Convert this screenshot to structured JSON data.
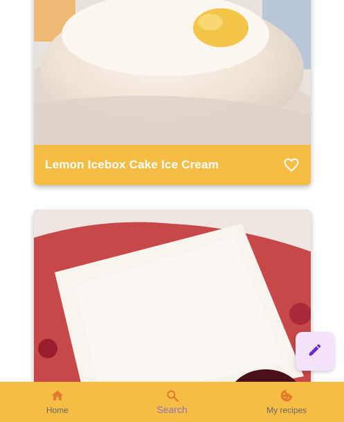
{
  "recipes": [
    {
      "title": "Lemon Icebox Cake Ice Cream",
      "favorite_icon": "heart-outline-icon"
    },
    {
      "title": "",
      "favorite_icon": "heart-outline-icon"
    }
  ],
  "fab": {
    "icon": "pencil-icon"
  },
  "bottom_nav": {
    "items": [
      {
        "label": "Home",
        "icon": "home-icon",
        "active": false
      },
      {
        "label": "Search",
        "icon": "search-icon",
        "active": true
      },
      {
        "label": "My recipes",
        "icon": "cookie-icon",
        "active": false
      }
    ]
  },
  "colors": {
    "accent": "#f6bd45",
    "nav_active": "#8a6fc0",
    "fab_background": "#f4e4fb",
    "fab_icon": "#6a2bc7"
  }
}
